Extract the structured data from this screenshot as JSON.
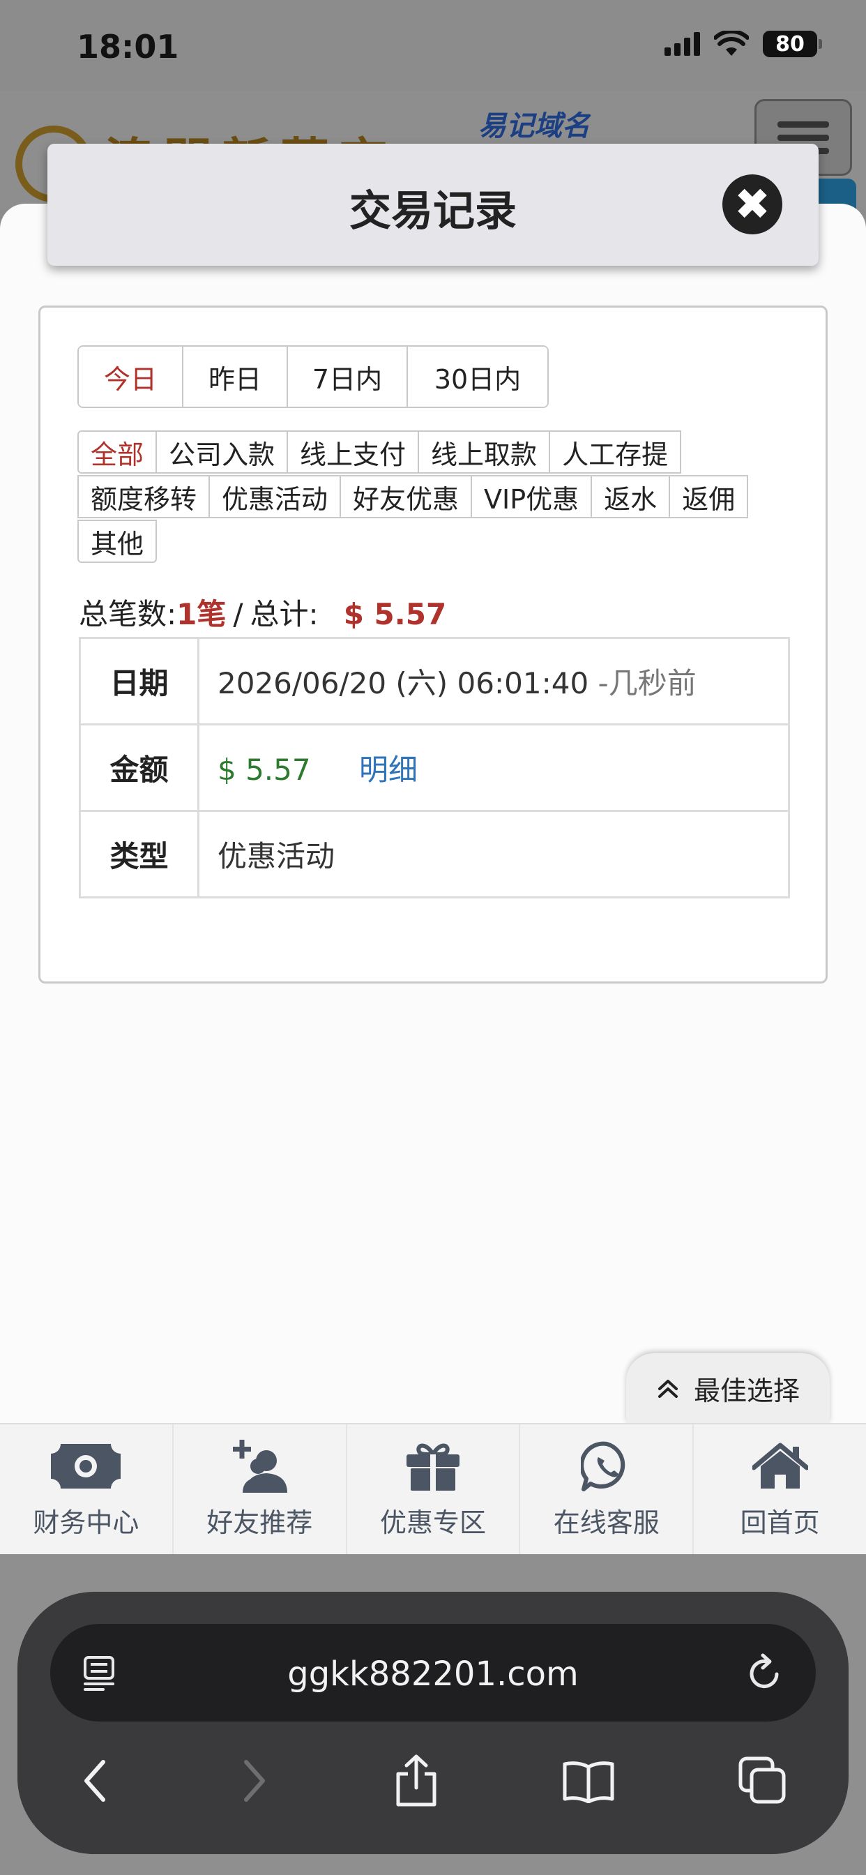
{
  "status_bar": {
    "time": "18:01",
    "battery": "80"
  },
  "site": {
    "domain_tag": "易记域名",
    "logo_text": "澳門新葡京"
  },
  "modal": {
    "title": "交易记录",
    "close_icon": "close-icon"
  },
  "date_tabs": [
    {
      "label": "今日",
      "active": true
    },
    {
      "label": "昨日",
      "active": false
    },
    {
      "label": "7日内",
      "active": false
    },
    {
      "label": "30日内",
      "active": false
    }
  ],
  "type_filters": [
    "全部",
    "公司入款",
    "线上支付",
    "线上取款",
    "人工存提",
    "额度移转",
    "优惠活动",
    "好友优惠",
    "VIP优惠",
    "返水",
    "返佣",
    "其他"
  ],
  "active_type": "全部",
  "summary": {
    "count_label": "总笔数:",
    "count_value": "1笔",
    "separator": "/",
    "total_label": "总计:",
    "total_value": "$ 5.57"
  },
  "record": {
    "date_label": "日期",
    "date_value": "2026/06/20 (六) 06:01:40",
    "date_relative": "-几秒前",
    "amount_label": "金额",
    "amount_value": "$ 5.57",
    "detail_link": "明细",
    "type_label": "类型",
    "type_value": "优惠活动"
  },
  "best_choice": "最佳选择",
  "bottom_nav": [
    {
      "label": "财务中心",
      "icon": "money-icon"
    },
    {
      "label": "好友推荐",
      "icon": "user-plus-icon"
    },
    {
      "label": "优惠专区",
      "icon": "gift-icon"
    },
    {
      "label": "在线客服",
      "icon": "whatsapp-icon"
    },
    {
      "label": "回首页",
      "icon": "home-icon"
    }
  ],
  "browser": {
    "url": "ggkk882201.com"
  }
}
